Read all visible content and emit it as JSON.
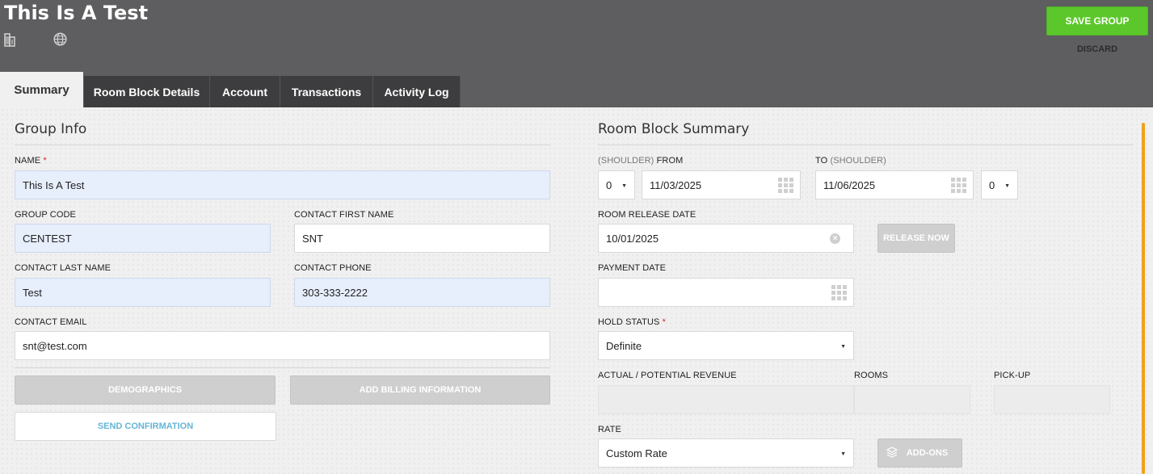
{
  "header": {
    "title": "This Is A Test",
    "icons": [
      "building-icon",
      "globe-icon"
    ],
    "save_label": "SAVE GROUP",
    "discard_label": "DISCARD"
  },
  "tabs": [
    {
      "label": "Summary",
      "active": true
    },
    {
      "label": "Room Block Details",
      "active": false
    },
    {
      "label": "Account",
      "active": false
    },
    {
      "label": "Transactions",
      "active": false
    },
    {
      "label": "Activity Log",
      "active": false
    }
  ],
  "group_info": {
    "title": "Group Info",
    "name_label": "NAME",
    "name_value": "This Is A Test",
    "group_code_label": "GROUP CODE",
    "group_code_value": "CENTEST",
    "contact_first_label": "CONTACT FIRST NAME",
    "contact_first_value": "SNT",
    "contact_last_label": "CONTACT LAST NAME",
    "contact_last_value": "Test",
    "contact_phone_label": "CONTACT PHONE",
    "contact_phone_value": "303-333-2222",
    "contact_email_label": "CONTACT EMAIL",
    "contact_email_value": "snt@test.com",
    "demographics_label": "DEMOGRAPHICS",
    "billing_label": "ADD BILLING INFORMATION",
    "send_confirmation_label": "SEND CONFIRMATION"
  },
  "room_block": {
    "title": "Room Block Summary",
    "from_shoulder": "(SHOULDER)",
    "from_label": "FROM",
    "to_label": "TO",
    "to_shoulder": "(SHOULDER)",
    "from_shoulder_value": "0",
    "from_date": "11/03/2025",
    "to_date": "11/06/2025",
    "to_shoulder_value": "0",
    "release_label": "ROOM RELEASE DATE",
    "release_value": "10/01/2025",
    "release_now_label": "RELEASE NOW",
    "payment_label": "PAYMENT DATE",
    "payment_value": "",
    "hold_status_label": "HOLD STATUS",
    "hold_status_value": "Definite",
    "revenue_label": "ACTUAL / POTENTIAL REVENUE",
    "rooms_label": "ROOMS",
    "pickup_label": "PICK-UP",
    "rate_label": "RATE",
    "rate_value": "Custom Rate",
    "addons_label": "ADD-ONS"
  },
  "colors": {
    "header_bg": "#5e5e60",
    "save_green": "#5cc72b",
    "scroll_accent": "#f0a21b",
    "required": "#d9232d",
    "link_blue": "#64b5d6"
  }
}
